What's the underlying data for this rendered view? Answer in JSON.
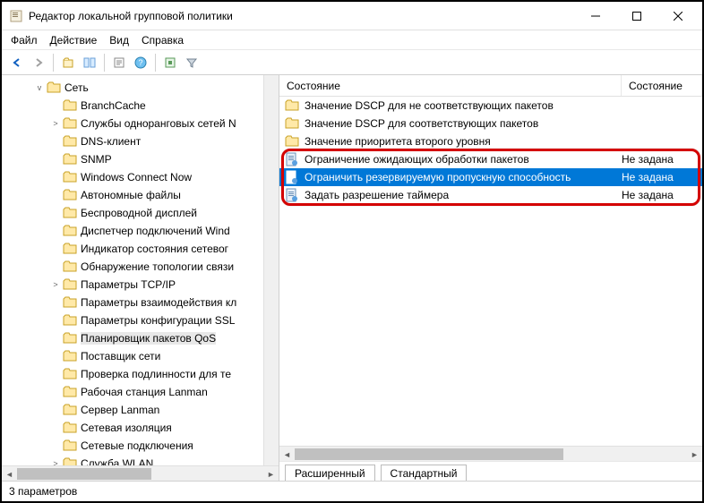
{
  "window": {
    "title": "Редактор локальной групповой политики"
  },
  "menu": {
    "file": "Файл",
    "action": "Действие",
    "view": "Вид",
    "help": "Справка"
  },
  "tree": {
    "root": "Сеть",
    "items": [
      {
        "expander": "",
        "label": "BranchCache"
      },
      {
        "expander": ">",
        "label": "Службы одноранговых сетей N"
      },
      {
        "expander": "",
        "label": "DNS-клиент"
      },
      {
        "expander": "",
        "label": "SNMP"
      },
      {
        "expander": "",
        "label": "Windows Connect Now"
      },
      {
        "expander": "",
        "label": "Автономные файлы"
      },
      {
        "expander": "",
        "label": "Беспроводной дисплей"
      },
      {
        "expander": "",
        "label": "Диспетчер подключений Wind"
      },
      {
        "expander": "",
        "label": "Индикатор состояния сетевог"
      },
      {
        "expander": "",
        "label": "Обнаружение топологии связи"
      },
      {
        "expander": ">",
        "label": "Параметры TCP/IP"
      },
      {
        "expander": "",
        "label": "Параметры взаимодействия кл"
      },
      {
        "expander": "",
        "label": "Параметры конфигурации SSL"
      },
      {
        "expander": "",
        "label": "Планировщик пакетов QoS",
        "selected": true
      },
      {
        "expander": "",
        "label": "Поставщик сети"
      },
      {
        "expander": "",
        "label": "Проверка подлинности для те"
      },
      {
        "expander": "",
        "label": "Рабочая станция Lanman"
      },
      {
        "expander": "",
        "label": "Сервер Lanman"
      },
      {
        "expander": "",
        "label": "Сетевая изоляция"
      },
      {
        "expander": "",
        "label": "Сетевые подключения"
      },
      {
        "expander": ">",
        "label": "Служба WLAN"
      }
    ]
  },
  "list": {
    "headers": {
      "setting": "Состояние",
      "state": "Состояние"
    },
    "rows": [
      {
        "icon": "folder",
        "text": "Значение DSCP для не соответствующих пакетов",
        "state": ""
      },
      {
        "icon": "folder",
        "text": "Значение DSCP для соответствующих пакетов",
        "state": ""
      },
      {
        "icon": "folder",
        "text": "Значение приоритета второго уровня",
        "state": ""
      },
      {
        "icon": "policy",
        "text": "Ограничение ожидающих обработки пакетов",
        "state": "Не задана"
      },
      {
        "icon": "policy",
        "text": "Ограничить резервируемую пропускную способность",
        "state": "Не задана",
        "selected": true
      },
      {
        "icon": "policy",
        "text": "Задать разрешение таймера",
        "state": "Не задана"
      }
    ]
  },
  "tabs": {
    "extended": "Расширенный",
    "standard": "Стандартный"
  },
  "status": "3 параметров"
}
